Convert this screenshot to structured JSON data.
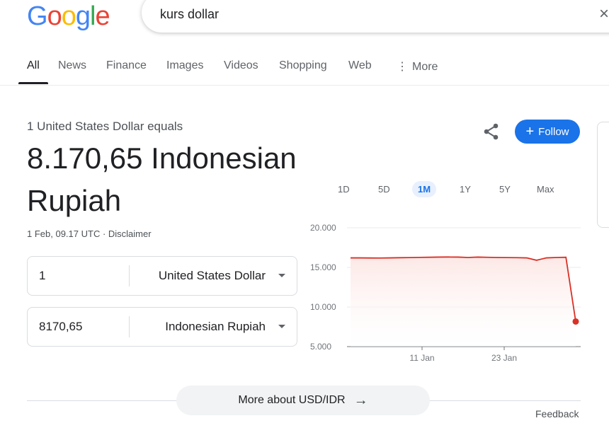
{
  "header": {
    "logo_letters": [
      {
        "char": "G",
        "color": "#4285f4"
      },
      {
        "char": "o",
        "color": "#ea4335"
      },
      {
        "char": "o",
        "color": "#fbbc05"
      },
      {
        "char": "g",
        "color": "#4285f4"
      },
      {
        "char": "l",
        "color": "#34a853"
      },
      {
        "char": "e",
        "color": "#ea4335"
      }
    ],
    "search_query": "kurs dollar",
    "clear_icon": "×"
  },
  "tabs": [
    {
      "label": "All",
      "active": true
    },
    {
      "label": "News"
    },
    {
      "label": "Finance"
    },
    {
      "label": "Images"
    },
    {
      "label": "Videos"
    },
    {
      "label": "Shopping"
    },
    {
      "label": "Web"
    },
    {
      "label": "More",
      "icon": "⋮"
    }
  ],
  "result": {
    "equals_label": "1 United States Dollar equals",
    "value_line1": "8.170,65 Indonesian",
    "value_line2": "Rupiah",
    "timestamp": "1 Feb, 09.17 UTC · Disclaimer",
    "follow_label": "Follow",
    "follow_plus": "+",
    "converter": [
      {
        "amount": "1",
        "currency": "United States Dollar"
      },
      {
        "amount": "8170,65",
        "currency": "Indonesian Rupiah"
      }
    ]
  },
  "ranges": [
    {
      "label": "1D"
    },
    {
      "label": "5D"
    },
    {
      "label": "1M",
      "active": true
    },
    {
      "label": "1Y"
    },
    {
      "label": "5Y"
    },
    {
      "label": "Max"
    }
  ],
  "chart_data": {
    "type": "area",
    "y_ticks": [
      "20.000",
      "15.000",
      "10.000",
      "5.000"
    ],
    "ylim": [
      5000,
      20000
    ],
    "x_ticks": [
      "11 Jan",
      "23 Jan"
    ],
    "series": [
      {
        "values": [
          16200,
          16200,
          16190,
          16180,
          16200,
          16220,
          16240,
          16260,
          16280,
          16300,
          16310,
          16300,
          16250,
          16300,
          16270,
          16250,
          16240,
          16230,
          16200,
          15900,
          16200,
          16250,
          16280,
          8170.65
        ]
      }
    ],
    "colors": {
      "line": "#d93025",
      "fill": "#fce8e6"
    }
  },
  "footer": {
    "more_label": "More about USD/IDR",
    "arrow": "→",
    "feedback": "Feedback"
  }
}
